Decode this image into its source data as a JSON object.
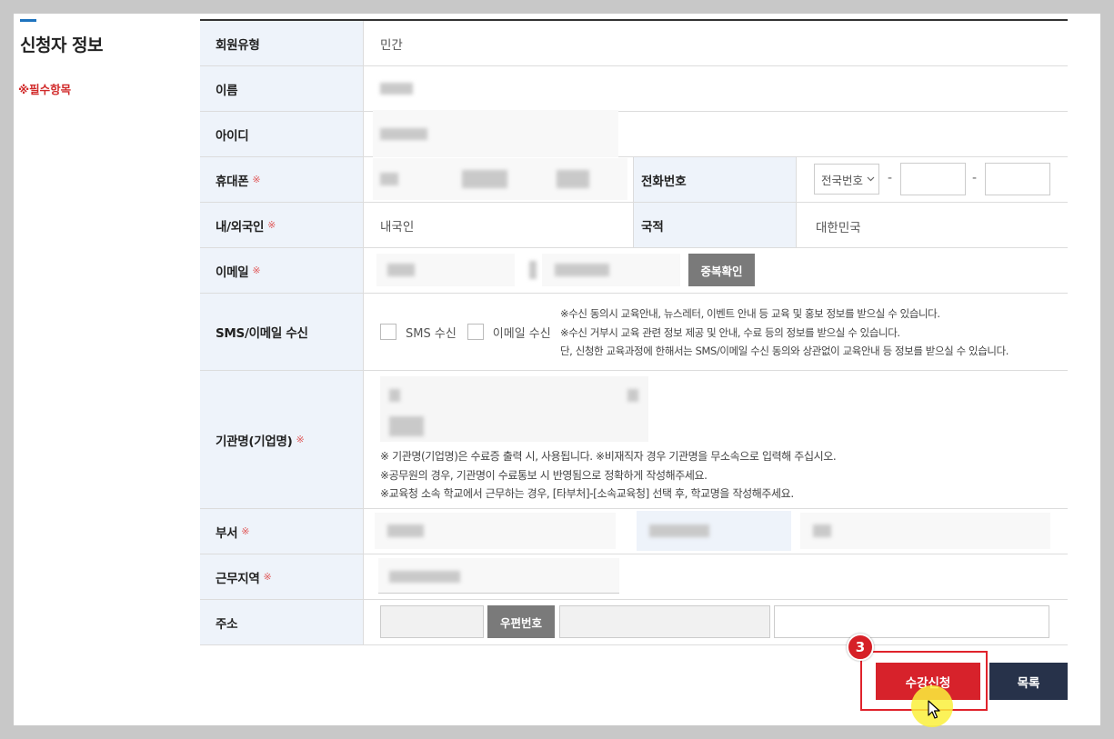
{
  "section": {
    "title": "신청자 정보",
    "required_note": "※필수항목"
  },
  "fields": {
    "member_type": {
      "label": "회원유형",
      "value": "민간"
    },
    "name": {
      "label": "이름"
    },
    "user_id": {
      "label": "아이디"
    },
    "mobile": {
      "label": "휴대폰",
      "req": "※"
    },
    "phone": {
      "label": "전화번호",
      "area_select": "전국번호",
      "dash": "-"
    },
    "nationality_type": {
      "label": "내/외국인",
      "req": "※",
      "value": "내국인"
    },
    "nationality": {
      "label": "국적",
      "value": "대한민국"
    },
    "email": {
      "label": "이메일",
      "req": "※",
      "check_button": "중복확인"
    },
    "sms_email": {
      "label": "SMS/이메일 수신",
      "sms_option": "SMS 수신",
      "email_option": "이메일 수신",
      "notice": [
        "※수신 동의시 교육안내, 뉴스레터, 이벤트 안내 등 교육 및 홍보 정보를 받으실 수 있습니다.",
        "※수신 거부시 교육 관련 정보 제공 및 안내, 수료 등의 정보를 받으실 수 있습니다.",
        "단, 신청한 교육과정에 한해서는 SMS/이메일 수신 동의와 상관없이 교육안내 등 정보를 받으실 수 있습니다."
      ]
    },
    "org": {
      "label": "기관명(기업명)",
      "req": "※",
      "notice": [
        "※ 기관명(기업명)은 수료증 출력 시, 사용됩니다. ※비재직자 경우 기관명을 무소속으로 입력해 주십시오.",
        "※공무원의 경우, 기관명이 수료통보 시 반영됨으로 정확하게 작성해주세요.",
        "※교육청 소속 학교에서 근무하는 경우, [타부처]-[소속교육청] 선택 후, 학교명을 작성해주세요."
      ]
    },
    "department": {
      "label": "부서",
      "req": "※"
    },
    "work_region": {
      "label": "근무지역",
      "req": "※"
    },
    "address": {
      "label": "주소",
      "zip_button": "우편번호"
    }
  },
  "actions": {
    "apply": "수강신청",
    "list": "목록"
  },
  "annotation": {
    "step": "3"
  },
  "colors": {
    "accent_blue": "#1e73be",
    "apply_red": "#d7222b",
    "list_navy": "#27324a",
    "header_bg": "#eef3fa"
  }
}
